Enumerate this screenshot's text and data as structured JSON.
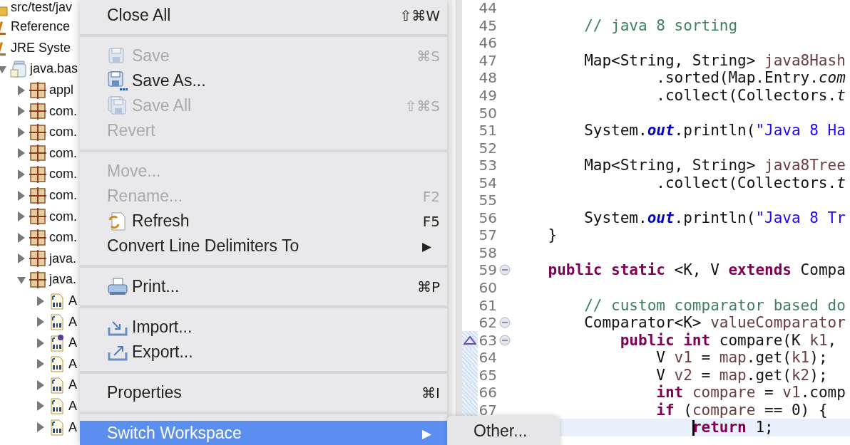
{
  "tree": [
    {
      "label": "src/test/jav",
      "kind": "folder"
    },
    {
      "label": "Reference",
      "kind": "library"
    },
    {
      "label": "JRE Syste",
      "kind": "library",
      "children": [
        {
          "label": "java.bas",
          "kind": "jar",
          "expanded": true,
          "children": [
            {
              "label": "appl",
              "kind": "package",
              "expanded": false
            },
            {
              "label": "com.",
              "kind": "package",
              "expanded": false
            },
            {
              "label": "com.",
              "kind": "package",
              "expanded": false
            },
            {
              "label": "com.",
              "kind": "package",
              "expanded": false
            },
            {
              "label": "com.",
              "kind": "package",
              "expanded": false
            },
            {
              "label": "com.",
              "kind": "package",
              "expanded": false
            },
            {
              "label": "com.",
              "kind": "package",
              "expanded": false
            },
            {
              "label": "com.",
              "kind": "package",
              "expanded": false
            },
            {
              "label": "java.",
              "kind": "package",
              "expanded": false
            },
            {
              "label": "java.",
              "kind": "package",
              "expanded": true,
              "children": [
                {
                  "label": "A",
                  "kind": "class",
                  "expanded": false
                },
                {
                  "label": "A",
                  "kind": "class",
                  "expanded": false
                },
                {
                  "label": "A",
                  "kind": "interface",
                  "expanded": false
                },
                {
                  "label": "A",
                  "kind": "class",
                  "expanded": false
                },
                {
                  "label": "A",
                  "kind": "class",
                  "expanded": false
                },
                {
                  "label": "A",
                  "kind": "class",
                  "expanded": false
                },
                {
                  "label": "A",
                  "kind": "class",
                  "expanded": false
                }
              ]
            }
          ]
        }
      ]
    }
  ],
  "menu": {
    "items": [
      {
        "kind": "item",
        "label": "Close All",
        "shortcut": "⇧⌘W",
        "enabled": true,
        "selected": false
      },
      {
        "kind": "separator"
      },
      {
        "kind": "item",
        "label": "Save",
        "shortcut": "⌘S",
        "enabled": false,
        "selected": false
      },
      {
        "kind": "item",
        "label": "Save As...",
        "enabled": true,
        "selected": false
      },
      {
        "kind": "item",
        "label": "Save All",
        "shortcut": "⇧⌘S",
        "enabled": false,
        "selected": false
      },
      {
        "kind": "item",
        "label": "Revert",
        "enabled": false,
        "selected": false
      },
      {
        "kind": "separator"
      },
      {
        "kind": "item",
        "label": "Move...",
        "enabled": false,
        "selected": false
      },
      {
        "kind": "item",
        "label": "Rename...",
        "shortcut": "F2",
        "enabled": false,
        "selected": false
      },
      {
        "kind": "item",
        "label": "Refresh",
        "shortcut": "F5",
        "enabled": true,
        "selected": false
      },
      {
        "kind": "item",
        "label": "Convert Line Delimiters To",
        "submenu": "▶",
        "enabled": true,
        "selected": false
      },
      {
        "kind": "separator"
      },
      {
        "kind": "item",
        "label": "Print...",
        "shortcut": "⌘P",
        "enabled": true,
        "selected": false
      },
      {
        "kind": "separator"
      },
      {
        "kind": "item",
        "label": "Import...",
        "enabled": true,
        "selected": false
      },
      {
        "kind": "item",
        "label": "Export...",
        "enabled": true,
        "selected": false
      },
      {
        "kind": "separator"
      },
      {
        "kind": "item",
        "label": "Properties",
        "shortcut": "⌘I",
        "enabled": true,
        "selected": false
      },
      {
        "kind": "separator"
      },
      {
        "kind": "item",
        "label": "Switch Workspace",
        "submenu": "▶",
        "enabled": true,
        "selected": true
      }
    ]
  },
  "submenu": {
    "items": [
      {
        "label": "Other...",
        "selected": false
      }
    ]
  },
  "editor": {
    "lines": [
      {
        "number": "44",
        "changed": false,
        "current": false,
        "override": false
      },
      {
        "number": "45",
        "changed": false,
        "current": false,
        "override": false,
        "tokens": [
          {
            "kind": "comment",
            "text": "        // java 8 sorting"
          }
        ]
      },
      {
        "number": "46",
        "changed": false,
        "current": false,
        "override": false
      },
      {
        "number": "47",
        "changed": false,
        "current": false,
        "override": false,
        "tokens": [
          {
            "kind": "plain",
            "text": "        Map<String, String> "
          },
          {
            "kind": "local",
            "text": "java8Hash"
          }
        ]
      },
      {
        "number": "48",
        "changed": false,
        "current": false,
        "override": false,
        "tokens": [
          {
            "kind": "plain",
            "text": "                .sorted(Map.Entry."
          },
          {
            "kind": "static",
            "text": "com"
          }
        ]
      },
      {
        "number": "49",
        "changed": false,
        "current": false,
        "override": false,
        "tokens": [
          {
            "kind": "plain",
            "text": "                .collect(Collectors."
          },
          {
            "kind": "static",
            "text": "t"
          }
        ]
      },
      {
        "number": "50",
        "changed": false,
        "current": false,
        "override": false
      },
      {
        "number": "51",
        "changed": false,
        "current": false,
        "override": false,
        "tokens": [
          {
            "kind": "plain",
            "text": "        System."
          },
          {
            "kind": "field",
            "text": "out"
          },
          {
            "kind": "plain",
            "text": ".println("
          },
          {
            "kind": "string",
            "text": "\"Java 8 Ha"
          }
        ]
      },
      {
        "number": "52",
        "changed": false,
        "current": false,
        "override": false
      },
      {
        "number": "53",
        "changed": false,
        "current": false,
        "override": false,
        "tokens": [
          {
            "kind": "plain",
            "text": "        Map<String, String> "
          },
          {
            "kind": "local",
            "text": "java8Tree"
          }
        ]
      },
      {
        "number": "54",
        "changed": false,
        "current": false,
        "override": false,
        "tokens": [
          {
            "kind": "plain",
            "text": "                .collect(Collectors."
          },
          {
            "kind": "static",
            "text": "t"
          }
        ]
      },
      {
        "number": "55",
        "changed": false,
        "current": false,
        "override": false
      },
      {
        "number": "56",
        "changed": false,
        "current": false,
        "override": false,
        "tokens": [
          {
            "kind": "plain",
            "text": "        System."
          },
          {
            "kind": "field",
            "text": "out"
          },
          {
            "kind": "plain",
            "text": ".println("
          },
          {
            "kind": "string",
            "text": "\"Java 8 Tr"
          }
        ]
      },
      {
        "number": "57",
        "changed": false,
        "current": false,
        "override": false,
        "tokens": [
          {
            "kind": "plain",
            "text": "    }"
          }
        ]
      },
      {
        "number": "58",
        "changed": false,
        "current": false,
        "override": false
      },
      {
        "number": "59",
        "collapsed": false,
        "changed": false,
        "current": false,
        "override": false,
        "tokens": [
          {
            "kind": "keyword",
            "text": "    public static"
          },
          {
            "kind": "plain",
            "text": " <K, V "
          },
          {
            "kind": "keyword",
            "text": "extends"
          },
          {
            "kind": "plain",
            "text": " Compa"
          }
        ]
      },
      {
        "number": "60",
        "changed": false,
        "current": false,
        "override": false
      },
      {
        "number": "61",
        "changed": false,
        "current": false,
        "override": false,
        "tokens": [
          {
            "kind": "comment",
            "text": "        // custom comparator based do"
          }
        ]
      },
      {
        "number": "62",
        "collapsed": false,
        "changed": false,
        "current": false,
        "override": false,
        "tokens": [
          {
            "kind": "plain",
            "text": "        Comparator<K> "
          },
          {
            "kind": "local",
            "text": "valueComparator"
          }
        ]
      },
      {
        "number": "63",
        "collapsed": false,
        "changed": true,
        "current": false,
        "override": true,
        "tokens": [
          {
            "kind": "keyword",
            "text": "            public int"
          },
          {
            "kind": "plain",
            "text": " compare(K "
          },
          {
            "kind": "local",
            "text": "k1"
          },
          {
            "kind": "plain",
            "text": ","
          }
        ]
      },
      {
        "number": "64",
        "changed": true,
        "current": false,
        "override": false,
        "tokens": [
          {
            "kind": "plain",
            "text": "                V "
          },
          {
            "kind": "local",
            "text": "v1"
          },
          {
            "kind": "plain",
            "text": " = "
          },
          {
            "kind": "local",
            "text": "map"
          },
          {
            "kind": "plain",
            "text": ".get("
          },
          {
            "kind": "local",
            "text": "k1"
          },
          {
            "kind": "plain",
            "text": ");"
          }
        ]
      },
      {
        "number": "65",
        "changed": true,
        "current": false,
        "override": false,
        "tokens": [
          {
            "kind": "plain",
            "text": "                V "
          },
          {
            "kind": "local",
            "text": "v2"
          },
          {
            "kind": "plain",
            "text": " = "
          },
          {
            "kind": "local",
            "text": "map"
          },
          {
            "kind": "plain",
            "text": ".get("
          },
          {
            "kind": "local",
            "text": "k2"
          },
          {
            "kind": "plain",
            "text": ");"
          }
        ]
      },
      {
        "number": "66",
        "changed": true,
        "current": false,
        "override": false,
        "tokens": [
          {
            "kind": "keyword",
            "text": "                int "
          },
          {
            "kind": "local",
            "text": "compare"
          },
          {
            "kind": "plain",
            "text": " = "
          },
          {
            "kind": "local",
            "text": "v1"
          },
          {
            "kind": "plain",
            "text": ".comp"
          }
        ]
      },
      {
        "number": "67",
        "changed": true,
        "current": false,
        "override": false,
        "tokens": [
          {
            "kind": "keyword",
            "text": "                if"
          },
          {
            "kind": "plain",
            "text": " ("
          },
          {
            "kind": "local",
            "text": "compare"
          },
          {
            "kind": "plain",
            "text": " == 0) {"
          }
        ]
      },
      {
        "changed": false,
        "current": true,
        "override": false,
        "tokens": [
          {
            "kind": "keyword",
            "text": "                    return"
          },
          {
            "kind": "plain",
            "text": " 1;"
          }
        ]
      }
    ]
  }
}
